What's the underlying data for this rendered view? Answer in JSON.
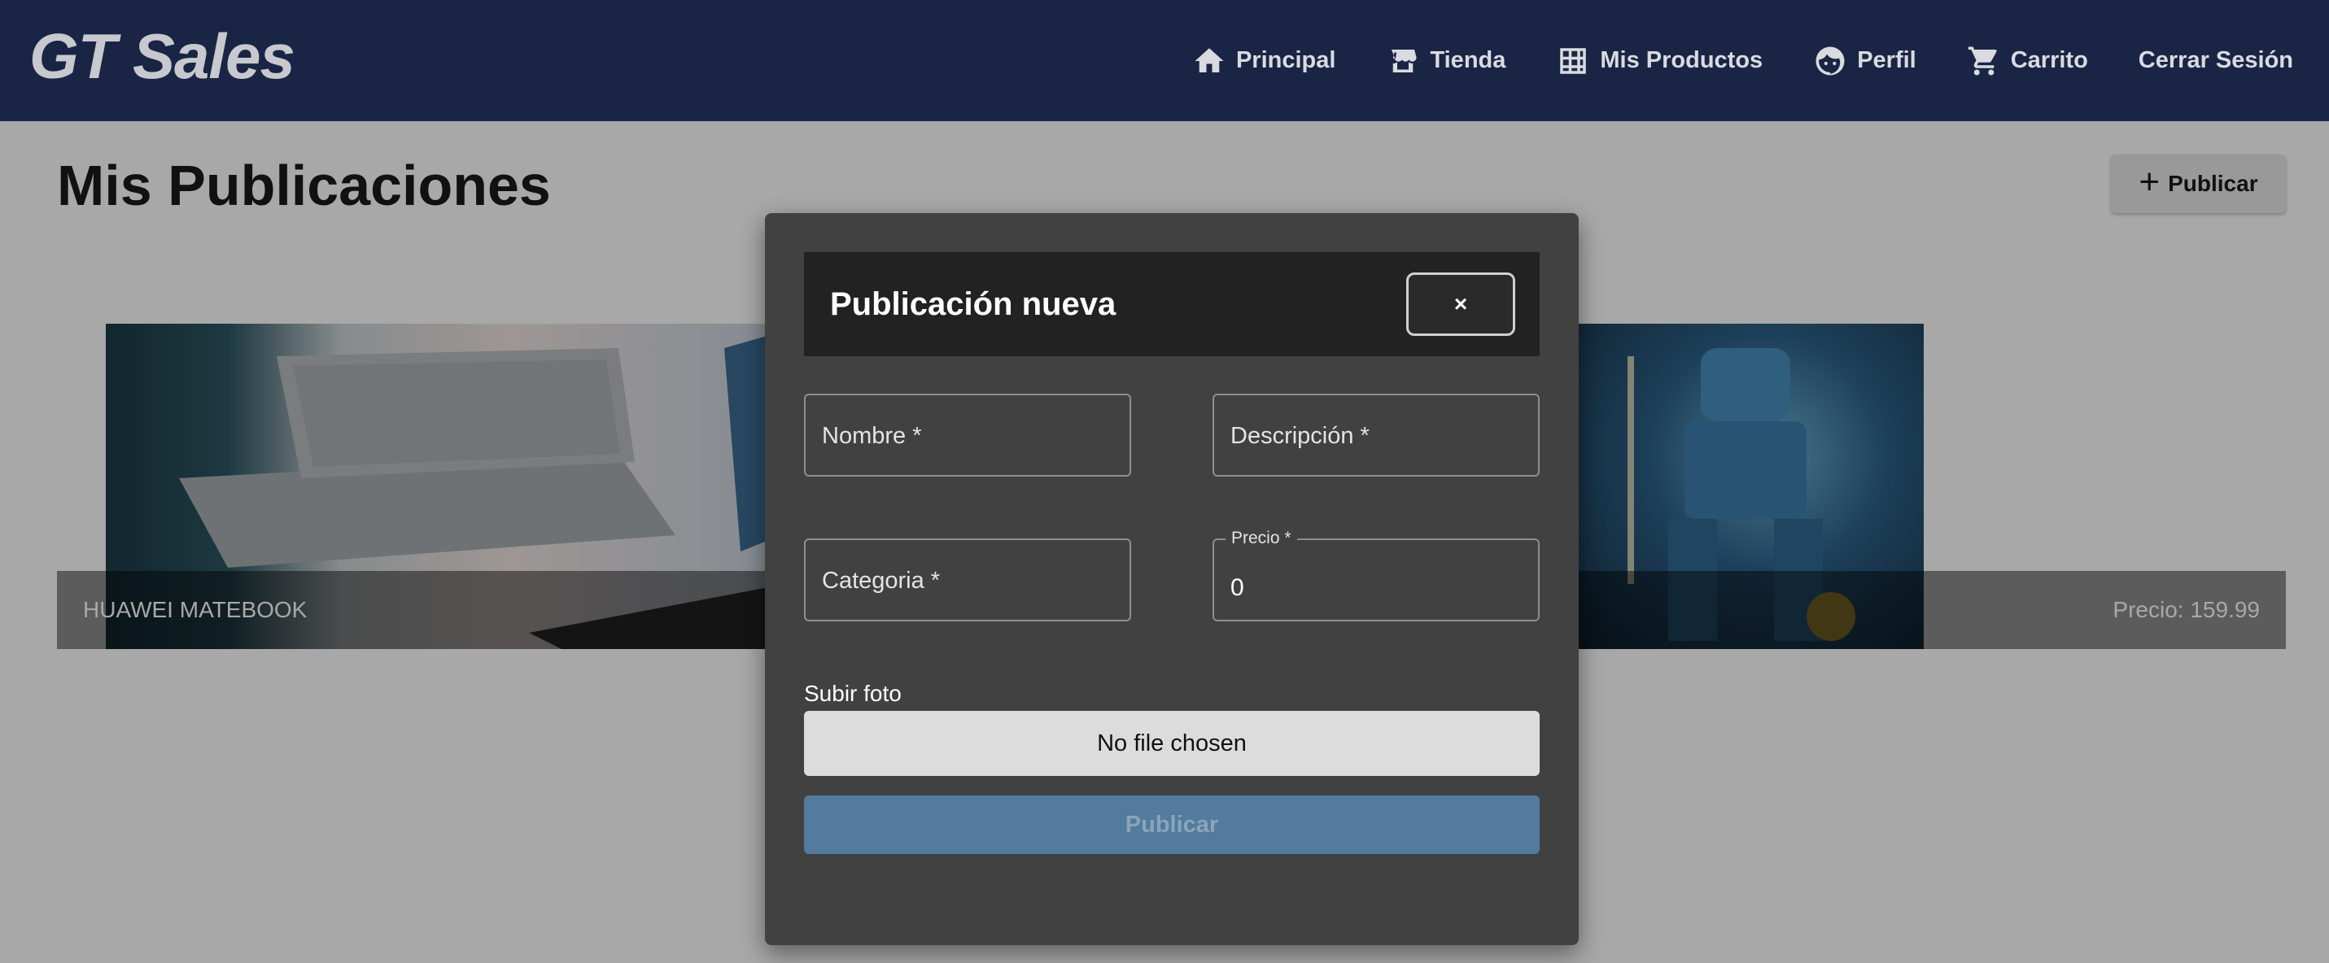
{
  "header": {
    "brand": "GT Sales",
    "nav": [
      {
        "label": "Principal",
        "icon": "home-icon"
      },
      {
        "label": "Tienda",
        "icon": "storefront-icon"
      },
      {
        "label": "Mis Productos",
        "icon": "grid-icon"
      },
      {
        "label": "Perfil",
        "icon": "face-icon"
      },
      {
        "label": "Carrito",
        "icon": "cart-icon"
      },
      {
        "label": "Cerrar Sesión",
        "icon": ""
      }
    ]
  },
  "page": {
    "title": "Mis Publicaciones",
    "publish_button": "Publicar",
    "publish_icon": "plus-icon",
    "cards": [
      {
        "name": "HUAWEI MATEBOOK",
        "price": "Precio: 159.99"
      }
    ]
  },
  "modal": {
    "title": "Publicación nueva",
    "close_label": "×",
    "fields": {
      "nombre": {
        "placeholder": "Nombre *"
      },
      "descripcion": {
        "placeholder": "Descripción *"
      },
      "categoria": {
        "placeholder": "Categoria *"
      },
      "precio": {
        "label": "Precio *",
        "value": "0"
      }
    },
    "upload_label": "Subir foto",
    "file_button": "No file chosen",
    "submit_label": "Publicar"
  },
  "colors": {
    "header_bg": "#1a2545",
    "modal_bg": "#414141",
    "modal_header_bg": "#222222",
    "submit_bg": "#527b9d"
  }
}
